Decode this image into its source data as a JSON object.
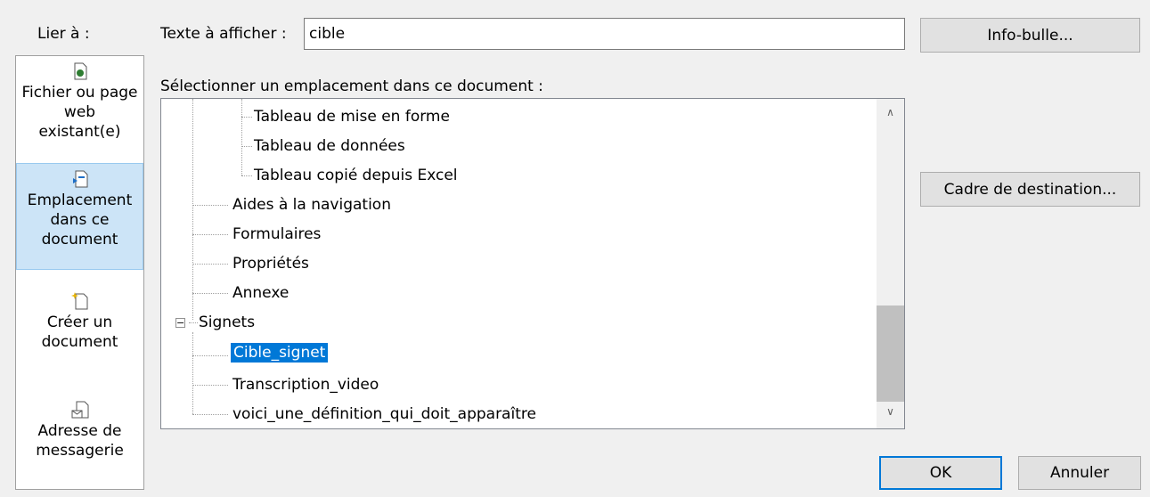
{
  "left_panel": {
    "label": "Lier à :",
    "items": [
      {
        "label": "Fichier ou page web existant(e)",
        "icon": "existing-file-icon",
        "selected": false
      },
      {
        "label": "Emplacement dans ce document",
        "icon": "place-in-document-icon",
        "selected": true
      },
      {
        "label": "Créer un document",
        "icon": "new-document-icon",
        "selected": false
      },
      {
        "label": "Adresse de messagerie",
        "icon": "email-address-icon",
        "selected": false
      }
    ]
  },
  "text_to_display": {
    "label": "Texte à afficher :",
    "value": "cible"
  },
  "info_bulle_button": "Info-bulle...",
  "select_location_label": "Sélectionner un emplacement dans ce document :",
  "tree": [
    {
      "label": "Tableau de mise en forme",
      "selected": false
    },
    {
      "label": "Tableau de données",
      "selected": false
    },
    {
      "label": "Tableau copié depuis Excel",
      "selected": false
    },
    {
      "label": "Aides à la navigation",
      "selected": false
    },
    {
      "label": "Formulaires",
      "selected": false
    },
    {
      "label": "Propriétés",
      "selected": false
    },
    {
      "label": "Annexe",
      "selected": false
    },
    {
      "label": "Signets",
      "selected": false
    },
    {
      "label": "Cible_signet",
      "selected": true
    },
    {
      "label": "Transcription_video",
      "selected": false
    },
    {
      "label": "voici_une_définition_qui_doit_apparaître",
      "selected": false
    }
  ],
  "target_frame_button": "Cadre de destination...",
  "ok_button": "OK",
  "cancel_button": "Annuler",
  "colors": {
    "selection": "#0078d7",
    "nav_selected": "#cce4f7",
    "default_button_border": "#0078d7"
  }
}
